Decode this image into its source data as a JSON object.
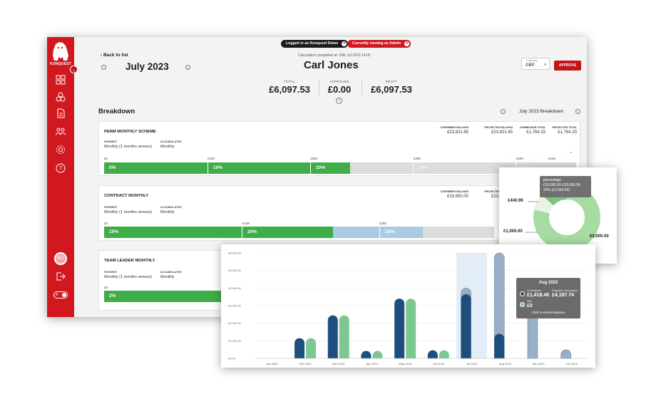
{
  "sidebar": {
    "logo_text": "KONQUEST",
    "avatar_initials": "KD",
    "toggle_label": "A"
  },
  "banner": {
    "logged_in": "Logged in as Konquest Demo",
    "viewing": "Currently viewing as Admin"
  },
  "header": {
    "back": "Back to list",
    "month": "July 2023",
    "calc": "Calculation completed at: 20th Jul 2023 14:05",
    "name": "Carl Jones",
    "currency_label": "Currency",
    "currency_value": "GBP",
    "approve": "APPROVE"
  },
  "totals": [
    {
      "label": "TOTAL",
      "value": "£6,097.53"
    },
    {
      "label": "APPROVED",
      "value": "£0.00"
    },
    {
      "label": "DRAFT",
      "value": "£6,097.53"
    }
  ],
  "breakdown": {
    "title": "Breakdown",
    "range": "July 2023 Breakdown"
  },
  "cards": [
    {
      "title": "PERM MONTHLY SCHEME",
      "payment_label": "PAYMENT",
      "payment_value": "Monthly (1 months arrears)",
      "accum_label": "ACCUMULATES",
      "accum_value": "Monthly",
      "stats": [
        {
          "label": "CONFIRMED BILLINGS",
          "value": "£23,821.65"
        },
        {
          "label": "PROJECTED BILLINGS",
          "value": "£23,821.65"
        },
        {
          "label": "COMMISSION TOTAL",
          "value": "£1,764.33"
        },
        {
          "label": "PROJECTED TOTAL",
          "value": "£1,764.33"
        }
      ],
      "ticks": [
        "£0",
        "£10K",
        "£20K",
        "£30K",
        "£40K",
        "£44K"
      ],
      "bars": [
        "0%",
        "10%",
        "20%",
        "30%",
        "40%"
      ]
    },
    {
      "title": "CONTRACT MONTHLY",
      "payment_label": "PAYMENT",
      "payment_value": "Monthly (1 months arrears)",
      "accum_label": "ACCUMULATES",
      "accum_value": "Monthly",
      "stats": [
        {
          "label": "CONFIRMED BILLINGS",
          "value": "£16,650.00"
        },
        {
          "label": "PROJECTED BILLINGS",
          "value": "£23,250.00"
        }
      ],
      "ticks": [
        "£0",
        "£10K",
        "£20K"
      ],
      "bars": [
        "10%",
        "20%",
        "20%"
      ]
    },
    {
      "title": "TEAM LEADER MONTHLY",
      "payment_label": "PAYMENT",
      "payment_value": "Monthly (1 months arrears)",
      "accum_label": "ACCUMULATES",
      "accum_value": "Monthly",
      "ticks": [
        "£0"
      ],
      "bars": [
        "2%"
      ]
    }
  ],
  "donut": {
    "tooltip_title": "percentage",
    "tooltip_line1": "£20,000.00-£29,999.99",
    "tooltip_line2": "20% (£2,000.00)",
    "labels": [
      "£440.96",
      "£1,000.00",
      "£2,000.00"
    ],
    "colors": [
      "#7dc27f",
      "#eaf4e8",
      "#a6dca1"
    ]
  },
  "chart_data": {
    "type": "bar",
    "categories": [
      "Jan 2023",
      "Feb 2023",
      "Mar 2023",
      "Apr 2023",
      "May 2023",
      "Jun 2023",
      "Jul 2023",
      "Aug 2023",
      "Sep 2023",
      "Oct 2023"
    ],
    "series": [
      {
        "name": "Commission",
        "color": "#1d4e7e",
        "values": [
          0,
          1150,
          2450,
          280,
          3400,
          350,
          3650,
          1400,
          0,
          0
        ]
      },
      {
        "name": "Paid",
        "color": "#7dc891",
        "values": [
          0,
          1150,
          2450,
          280,
          3400,
          350,
          0,
          0,
          0,
          0
        ]
      },
      {
        "name": "Projected Commission",
        "color": "#98afc5",
        "values": [
          0,
          0,
          0,
          0,
          0,
          0,
          4000,
          6000,
          4400,
          420
        ]
      }
    ],
    "y_ticks": [
      "£0.00",
      "£1,000.00",
      "£2,000.00",
      "£3,000.00",
      "£4,000.00",
      "£5,000.00",
      "£6,000.00"
    ],
    "ylim": [
      0,
      6000
    ],
    "highlight": "Jul 2023",
    "tooltip": {
      "title": "Aug 2023",
      "commission_label": "Commission",
      "commission_value": "£1,418.46",
      "projected_label": "Projected Commission",
      "projected_value": "£4,187.74",
      "paid_label": "Paid",
      "paid_value": "£0",
      "footer": "Click to view breakdown"
    }
  }
}
